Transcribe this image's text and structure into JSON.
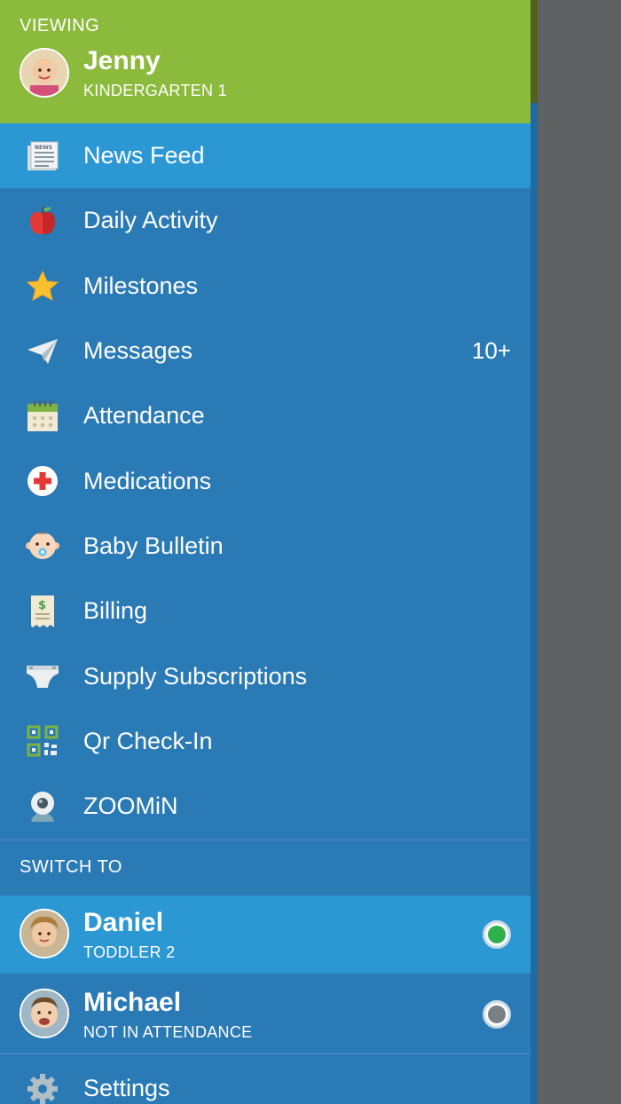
{
  "header": {
    "viewing_label": "VIEWING",
    "child": {
      "name": "Jenny",
      "class": "KINDERGARTEN 1"
    },
    "bg_color": "#8cba3c"
  },
  "menu": {
    "items": [
      {
        "label": "News Feed",
        "icon": "newspaper-icon",
        "active": true
      },
      {
        "label": "Daily Activity",
        "icon": "apple-icon"
      },
      {
        "label": "Milestones",
        "icon": "star-icon"
      },
      {
        "label": "Messages",
        "icon": "paper-plane-icon",
        "badge": "10+"
      },
      {
        "label": "Attendance",
        "icon": "calendar-icon"
      },
      {
        "label": "Medications",
        "icon": "medical-cross-icon"
      },
      {
        "label": "Baby Bulletin",
        "icon": "baby-face-icon"
      },
      {
        "label": "Billing",
        "icon": "receipt-icon"
      },
      {
        "label": "Supply Subscriptions",
        "icon": "diaper-icon"
      },
      {
        "label": "Qr Check-In",
        "icon": "qr-code-icon"
      },
      {
        "label": "ZOOMiN",
        "icon": "webcam-icon"
      }
    ]
  },
  "switch_to": {
    "label": "SWITCH TO",
    "children": [
      {
        "name": "Daniel",
        "status": "TODDLER 2",
        "indicator_color": "#2fb04a",
        "active": true
      },
      {
        "name": "Michael",
        "status": "NOT IN ATTENDANCE",
        "indicator_color": "#7a7f84"
      }
    ]
  },
  "settings": {
    "label": "Settings",
    "icon": "gear-icon"
  },
  "colors": {
    "drawer": "#2a7ab5",
    "active": "#2b97d3",
    "overlay": "#5f6163"
  }
}
